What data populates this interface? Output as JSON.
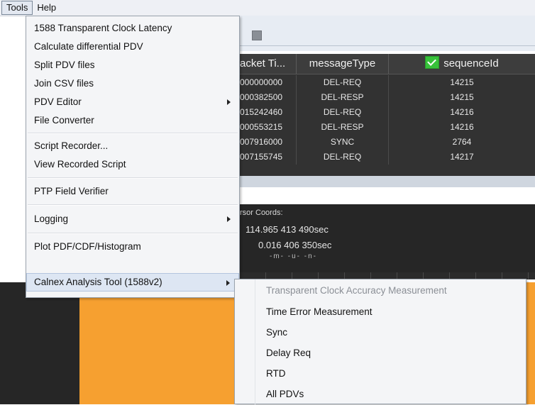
{
  "menubar": {
    "items": [
      {
        "label": "Tools",
        "active": true
      },
      {
        "label": "Help",
        "active": false
      }
    ]
  },
  "tools_menu": {
    "items": [
      {
        "label": "1588 Transparent Clock Latency",
        "has_submenu": false
      },
      {
        "label": "Calculate differential PDV",
        "has_submenu": false
      },
      {
        "label": "Split PDV files",
        "has_submenu": false
      },
      {
        "label": "Join CSV files",
        "has_submenu": false
      },
      {
        "label": "PDV Editor",
        "has_submenu": true
      },
      {
        "label": "File Converter",
        "has_submenu": false
      },
      {
        "label": "Script Recorder...",
        "has_submenu": false
      },
      {
        "label": "View Recorded Script",
        "has_submenu": false
      },
      {
        "label": "PTP Field Verifier",
        "has_submenu": false
      },
      {
        "label": "Logging",
        "has_submenu": true
      },
      {
        "label": "Plot PDF/CDF/Histogram",
        "has_submenu": false
      },
      {
        "label": "Calnex Analysis Tool (1588v2)",
        "has_submenu": true,
        "highlighted": true
      }
    ]
  },
  "analysis_submenu": {
    "items": [
      {
        "label": "Transparent Clock Accuracy Measurement",
        "enabled": false
      },
      {
        "label": "Time Error Measurement",
        "enabled": true
      },
      {
        "label": "Sync",
        "enabled": true
      },
      {
        "label": "Delay Req",
        "enabled": true
      },
      {
        "label": "RTD",
        "enabled": true
      },
      {
        "label": "All PDVs",
        "enabled": true
      }
    ]
  },
  "packet_table": {
    "headers": {
      "packet_time": "acket Ti...",
      "message_type": "messageType",
      "sequence_id": "sequenceId"
    },
    "sequence_checked": true,
    "rows": [
      {
        "time": "000000000",
        "type": "DEL-REQ",
        "seq": "14215"
      },
      {
        "time": "000382500",
        "type": "DEL-RESP",
        "seq": "14215"
      },
      {
        "time": "015242460",
        "type": "DEL-REQ",
        "seq": "14216"
      },
      {
        "time": "000553215",
        "type": "DEL-RESP",
        "seq": "14216"
      },
      {
        "time": "007916000",
        "type": "SYNC",
        "seq": "2764"
      },
      {
        "time": "007155745",
        "type": "DEL-REQ",
        "seq": "14217"
      }
    ]
  },
  "cursor_panel": {
    "label": "rsor Coords:",
    "value1": "114.965 413 490sec",
    "value2": "0.016 406 350sec",
    "units": "-m- -u- -n-"
  },
  "colors": {
    "plot_fill": "#f6a030",
    "check_green": "#37c23a",
    "menu_highlight": "#dde6f3"
  }
}
